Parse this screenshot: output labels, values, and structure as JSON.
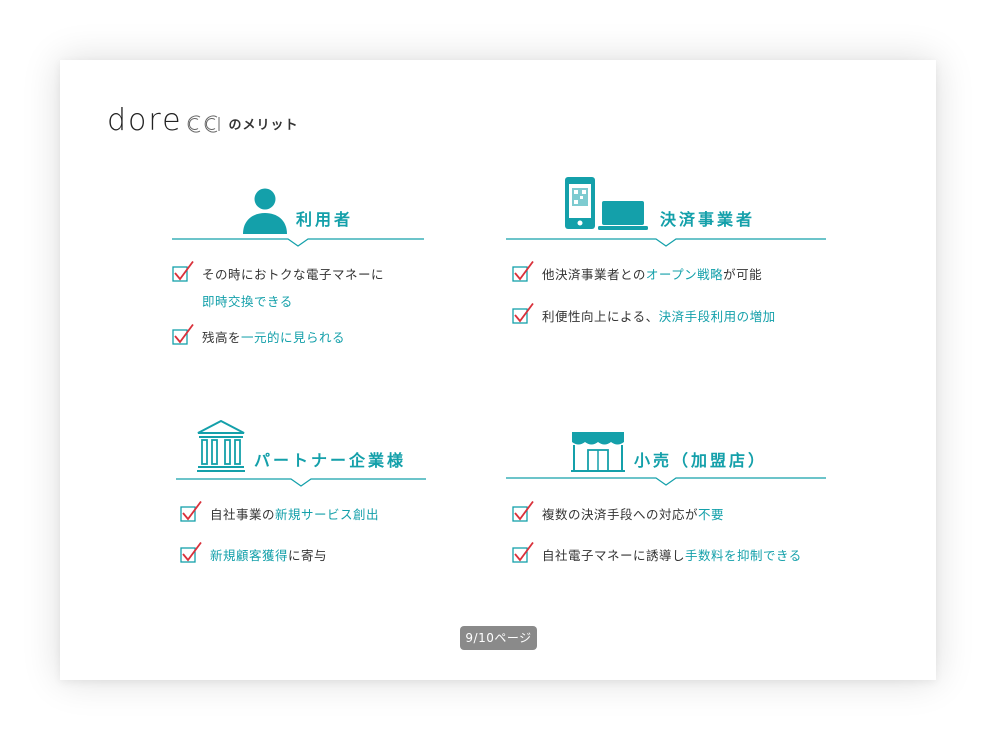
{
  "logo": {
    "brand": "dore",
    "tail": "のメリット"
  },
  "colors": {
    "accent": "#14a0aa",
    "check_red": "#d9313b",
    "text": "#333333"
  },
  "sections": {
    "users": {
      "title": "利用者",
      "icon": "user-icon",
      "items": [
        {
          "normal_pre": "その時におトクな電子マネーに",
          "highlight_newline": "即時交換できる"
        },
        {
          "normal_pre": "残高を",
          "highlight": "一元的に見られる"
        }
      ]
    },
    "payment": {
      "title": "決済事業者",
      "icon": "smartphone-laptop-icon",
      "items": [
        {
          "normal_pre": "他決済事業者との",
          "highlight": "オープン戦略",
          "normal_post": "が可能"
        },
        {
          "normal_pre": "利便性向上による、",
          "highlight": "決済手段利用の増加"
        }
      ]
    },
    "partner": {
      "title": "パートナー企業様",
      "icon": "bank-building-icon",
      "items": [
        {
          "normal_pre": "自社事業の",
          "highlight": "新規サービス創出"
        },
        {
          "highlight": "新規顧客獲得",
          "normal_post": "に寄与"
        }
      ]
    },
    "retail": {
      "title": "小売（加盟店）",
      "icon": "storefront-icon",
      "items": [
        {
          "normal_pre": "複数の決済手段への対応が",
          "highlight": "不要"
        },
        {
          "normal_pre": "自社電子マネーに誘導し",
          "highlight": "手数料を抑制できる"
        }
      ]
    }
  },
  "page_indicator": "9/10ページ"
}
